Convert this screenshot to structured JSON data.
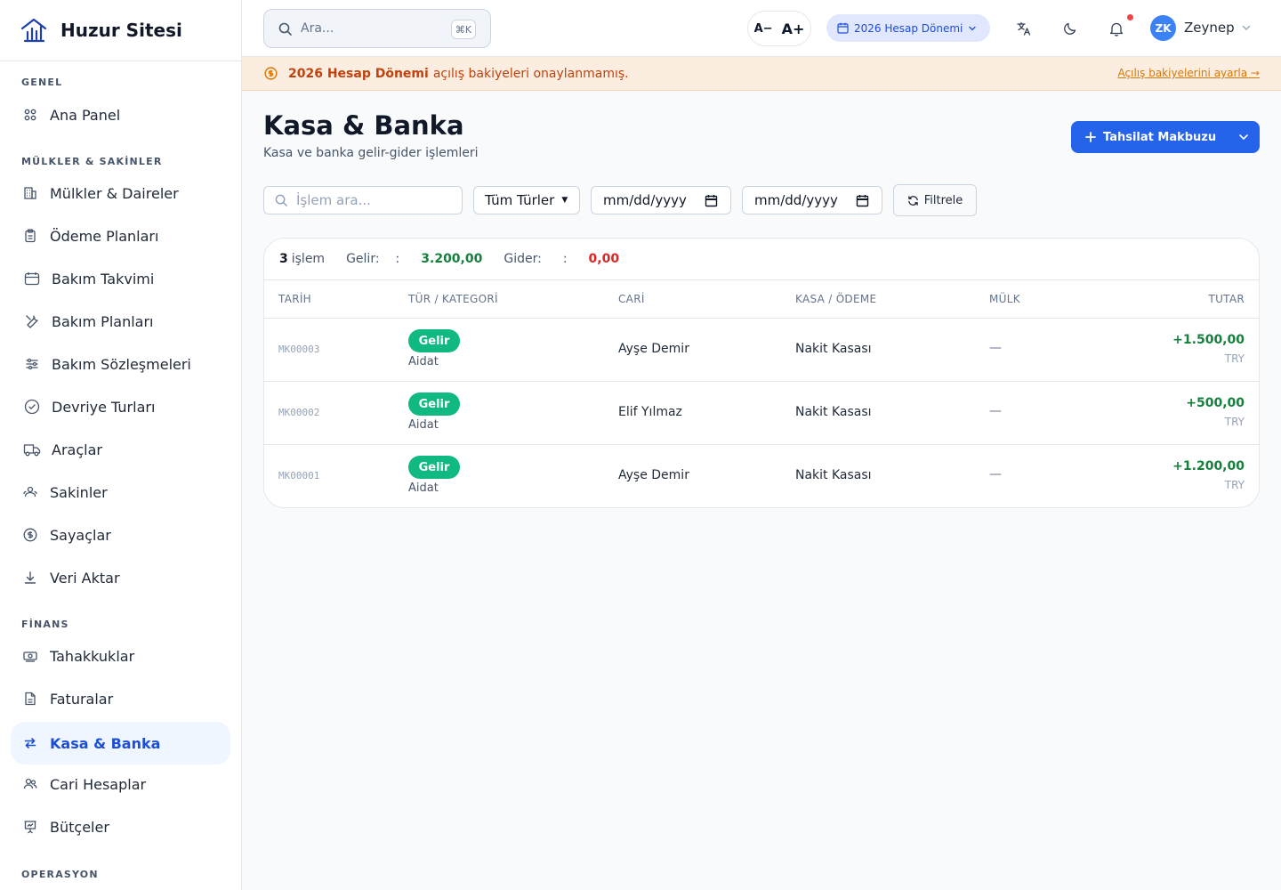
{
  "brand": {
    "name": "Huzur Sitesi"
  },
  "sidebar": {
    "sections": [
      {
        "title": "GENEL",
        "items": [
          {
            "label": "Ana Panel",
            "icon": "grid-icon"
          }
        ]
      },
      {
        "title": "MÜLKLER & SAKİNLER",
        "items": [
          {
            "label": "Mülkler & Daireler",
            "icon": "building-icon"
          },
          {
            "label": "Ödeme Planları",
            "icon": "clipboard-icon"
          },
          {
            "label": "Bakım Takvimi",
            "icon": "calendar-icon"
          },
          {
            "label": "Bakım Planları",
            "icon": "wrench-icon"
          },
          {
            "label": "Bakım Sözleşmeleri",
            "icon": "sliders-icon"
          },
          {
            "label": "Devriye Turları",
            "icon": "check-circle-icon"
          },
          {
            "label": "Araçlar",
            "icon": "truck-icon"
          },
          {
            "label": "Sakinler",
            "icon": "users-icon"
          },
          {
            "label": "Sayaçlar",
            "icon": "dollar-circle-icon"
          },
          {
            "label": "Veri Aktar",
            "icon": "download-icon"
          }
        ]
      },
      {
        "title": "FİNANS",
        "items": [
          {
            "label": "Tahakkuklar",
            "icon": "banknote-icon"
          },
          {
            "label": "Faturalar",
            "icon": "file-icon"
          },
          {
            "label": "Kasa & Banka",
            "icon": "arrows-icon",
            "active": true
          },
          {
            "label": "Cari Hesaplar",
            "icon": "users-icon"
          },
          {
            "label": "Bütçeler",
            "icon": "presentation-icon"
          }
        ]
      },
      {
        "title": "OPERASYON",
        "items": []
      }
    ]
  },
  "topbar": {
    "search_placeholder": "Ara...",
    "search_shortcut": "⌘K",
    "font_decrease": "A−",
    "font_increase": "A+",
    "period_label": "2026 Hesap Dönemi",
    "user_initials": "ZK",
    "user_name": "Zeynep"
  },
  "banner": {
    "bold": "2026 Hesap Dönemi",
    "text": "açılış bakiyeleri onaylanmamış.",
    "link": "Açılış bakiyelerini ayarla →"
  },
  "page": {
    "title": "Kasa & Banka",
    "subtitle": "Kasa ve banka gelir-gider işlemleri",
    "primary_button": "Tahsilat Makbuzu"
  },
  "filters": {
    "search_placeholder": "İşlem ara...",
    "type_value": "Tüm Türler",
    "date_from": "mm/dd/yyyy",
    "date_to": "mm/dd/yyyy",
    "button": "Filtrele"
  },
  "summary": {
    "count": "3",
    "count_label": "işlem",
    "income_label": "Gelir:",
    "income_colon": ":",
    "income_value": "3.200,00",
    "expense_label": "Gider:",
    "expense_colon": ":",
    "expense_value": "0,00"
  },
  "table": {
    "columns": [
      "TARİH",
      "TÜR / KATEGORİ",
      "CARİ",
      "KASA / ÖDEME",
      "MÜLK",
      "TUTAR"
    ],
    "rows": [
      {
        "ref": "MK00003",
        "type": "Gelir",
        "category": "Aidat",
        "cari": "Ayşe Demir",
        "kasa": "Nakit Kasası",
        "mulk": "—",
        "amount": "+1.500,00",
        "currency": "TRY"
      },
      {
        "ref": "MK00002",
        "type": "Gelir",
        "category": "Aidat",
        "cari": "Elif Yılmaz",
        "kasa": "Nakit Kasası",
        "mulk": "—",
        "amount": "+500,00",
        "currency": "TRY"
      },
      {
        "ref": "MK00001",
        "type": "Gelir",
        "category": "Aidat",
        "cari": "Ayşe Demir",
        "kasa": "Nakit Kasası",
        "mulk": "—",
        "amount": "+1.200,00",
        "currency": "TRY"
      }
    ]
  },
  "colors": {
    "accent": "#2563eb",
    "income": "#15803d",
    "expense": "#dc2626",
    "badge": "#10b981",
    "banner_bg": "#fbeee0"
  }
}
